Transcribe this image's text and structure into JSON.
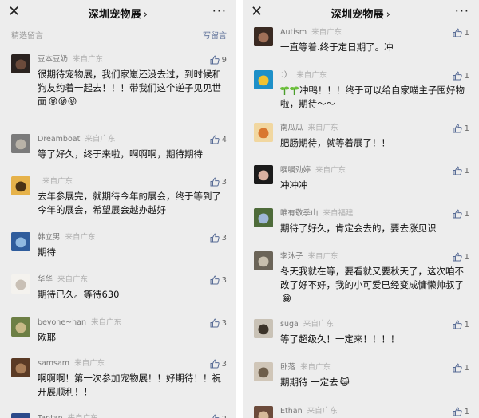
{
  "left": {
    "header": {
      "close": "✕",
      "title": "深圳宠物展",
      "chevron": "›",
      "more": "···"
    },
    "section": {
      "label": "精选留言",
      "write": "写留言"
    },
    "comments": [
      {
        "nick": "豆本豆奶",
        "loc": "来自广东",
        "likes": "9",
        "text": "很期待宠物展，我们家崽还没去过，到时候和狗友约着一起去！！！带我们这个逆子见见世面",
        "emoji": "😝😝😝",
        "avatar": "dark"
      },
      {
        "nick": "Dreamboat",
        "loc": "来自广东",
        "likes": "4",
        "text": "等了好久，终于来啦，啊啊啊，期待期待",
        "emoji": "",
        "avatar": "grey"
      },
      {
        "nick": "",
        "loc": "来自广东",
        "likes": "3",
        "text": "去年参展完，就期待今年的展会，终于等到了今年的展会，希望展会越办越好",
        "emoji": "",
        "avatar": "tiger"
      },
      {
        "nick": "韩立男",
        "loc": "来自广东",
        "likes": "3",
        "text": "期待",
        "emoji": "",
        "avatar": "sky"
      },
      {
        "nick": "华华",
        "loc": "来自广东",
        "likes": "3",
        "text": "期待已久。等待630",
        "emoji": "",
        "avatar": "white"
      },
      {
        "nick": "bevone~han",
        "loc": "来自广东",
        "likes": "3",
        "text": "欧耶",
        "emoji": "",
        "avatar": "field"
      },
      {
        "nick": "samsam",
        "loc": "来自广东",
        "likes": "3",
        "text": "啊啊啊！第一次参加宠物展！！好期待！！祝开展顺利！！",
        "emoji": "",
        "avatar": "brown"
      },
      {
        "nick": "Tantan",
        "loc": "来自广东",
        "likes": "2",
        "text": "",
        "emoji": "",
        "avatar": "blue"
      }
    ]
  },
  "right": {
    "header": {
      "close": "✕",
      "title": "深圳宠物展",
      "chevron": "›",
      "more": "···"
    },
    "comments": [
      {
        "nick": "Autism",
        "loc": "来自广东",
        "likes": "1",
        "text": "一直等着.终于定日期了。冲",
        "emoji": "",
        "avatar": "dog"
      },
      {
        "nick": "：）",
        "loc": "来自广东",
        "likes": "1",
        "text": "冲鸭！！！终于可以给自家喵主子囤好物啦，期待～～",
        "emoji": "",
        "avatar": "bird",
        "sprout": true
      },
      {
        "nick": "南瓜瓜",
        "loc": "来自广东",
        "likes": "1",
        "text": "肥肠期待，就等着展了！！",
        "emoji": "",
        "avatar": "cartoon"
      },
      {
        "nick": "嘱嘱劲婷",
        "loc": "来自广东",
        "likes": "1",
        "text": "冲冲冲",
        "emoji": "",
        "avatar": "girl"
      },
      {
        "nick": "唯有敬季山",
        "loc": "来自福建",
        "likes": "1",
        "text": "期待了好久，肯定会去的，要去涨见识",
        "emoji": "",
        "avatar": "mountain"
      },
      {
        "nick": "李沐子",
        "loc": "来自广东",
        "likes": "1",
        "text": "冬天我就在等，要看就又要秋天了，这次咱不改了好不好，我的小可爱已经变成慵懒帅叔了",
        "emoji": "😁",
        "avatar": "cat"
      },
      {
        "nick": "suga",
        "loc": "来自广东",
        "likes": "1",
        "text": "等了超级久！一定来！！！！",
        "emoji": "",
        "avatar": "dog2"
      },
      {
        "nick": "卧落",
        "loc": "来自广东",
        "likes": "1",
        "text": "期期待 一定去",
        "emoji": "😺",
        "avatar": "cat2"
      },
      {
        "nick": "Ethan",
        "loc": "来自广东",
        "likes": "1",
        "text": "",
        "emoji": "",
        "avatar": "ethan"
      }
    ]
  }
}
